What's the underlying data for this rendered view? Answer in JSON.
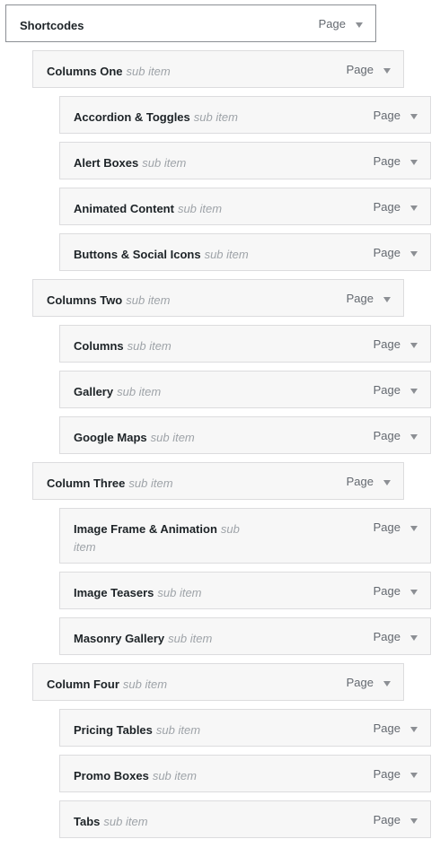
{
  "sub_item_label": "sub item",
  "menu_items": [
    {
      "title": "Shortcodes",
      "subtitle": "",
      "type": "Page",
      "depth": 0
    },
    {
      "title": "Columns One",
      "subtitle": "sub item",
      "type": "Page",
      "depth": 1
    },
    {
      "title": "Accordion & Toggles",
      "subtitle": "sub item",
      "type": "Page",
      "depth": 2
    },
    {
      "title": "Alert Boxes",
      "subtitle": "sub item",
      "type": "Page",
      "depth": 2
    },
    {
      "title": "Animated Content",
      "subtitle": "sub item",
      "type": "Page",
      "depth": 2
    },
    {
      "title": "Buttons & Social Icons",
      "subtitle": "sub item",
      "type": "Page",
      "depth": 2
    },
    {
      "title": "Columns Two",
      "subtitle": "sub item",
      "type": "Page",
      "depth": 1
    },
    {
      "title": "Columns",
      "subtitle": "sub item",
      "type": "Page",
      "depth": 2
    },
    {
      "title": "Gallery",
      "subtitle": "sub item",
      "type": "Page",
      "depth": 2
    },
    {
      "title": "Google Maps",
      "subtitle": "sub item",
      "type": "Page",
      "depth": 2
    },
    {
      "title": "Column Three",
      "subtitle": "sub item",
      "type": "Page",
      "depth": 1
    },
    {
      "title": "Image Frame & Animation",
      "subtitle": "sub item",
      "type": "Page",
      "depth": 2
    },
    {
      "title": "Image Teasers",
      "subtitle": "sub item",
      "type": "Page",
      "depth": 2
    },
    {
      "title": "Masonry Gallery",
      "subtitle": "sub item",
      "type": "Page",
      "depth": 2
    },
    {
      "title": "Column Four",
      "subtitle": "sub item",
      "type": "Page",
      "depth": 1
    },
    {
      "title": "Pricing Tables",
      "subtitle": "sub item",
      "type": "Page",
      "depth": 2
    },
    {
      "title": "Promo Boxes",
      "subtitle": "sub item",
      "type": "Page",
      "depth": 2
    },
    {
      "title": "Tabs",
      "subtitle": "sub item",
      "type": "Page",
      "depth": 2
    }
  ],
  "icons": {
    "toggle": "chevron-down-icon"
  }
}
